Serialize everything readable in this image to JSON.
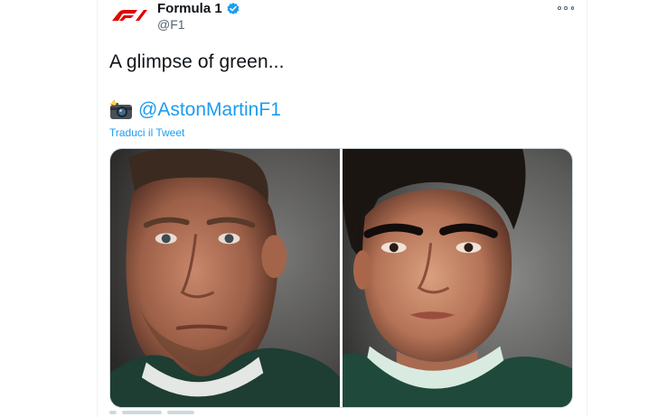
{
  "author": {
    "name": "Formula 1",
    "handle": "@F1",
    "avatar_icon": "f1-logo-icon",
    "verified_icon": "verified-badge-icon"
  },
  "tweet": {
    "text": "A glimpse of green...",
    "camera_icon": "camera-flash-emoji-icon",
    "mention": "@AstonMartinF1",
    "translate_label": "Traduci il Tweet"
  },
  "media": {
    "photos": [
      {
        "subject": "driver-portrait-1"
      },
      {
        "subject": "driver-portrait-2"
      }
    ]
  },
  "colors": {
    "brand_red": "#e10600",
    "link_blue": "#1d9bf0",
    "text_primary": "#0f1419",
    "text_secondary": "#536471",
    "racing_green": "#1e3d33"
  }
}
